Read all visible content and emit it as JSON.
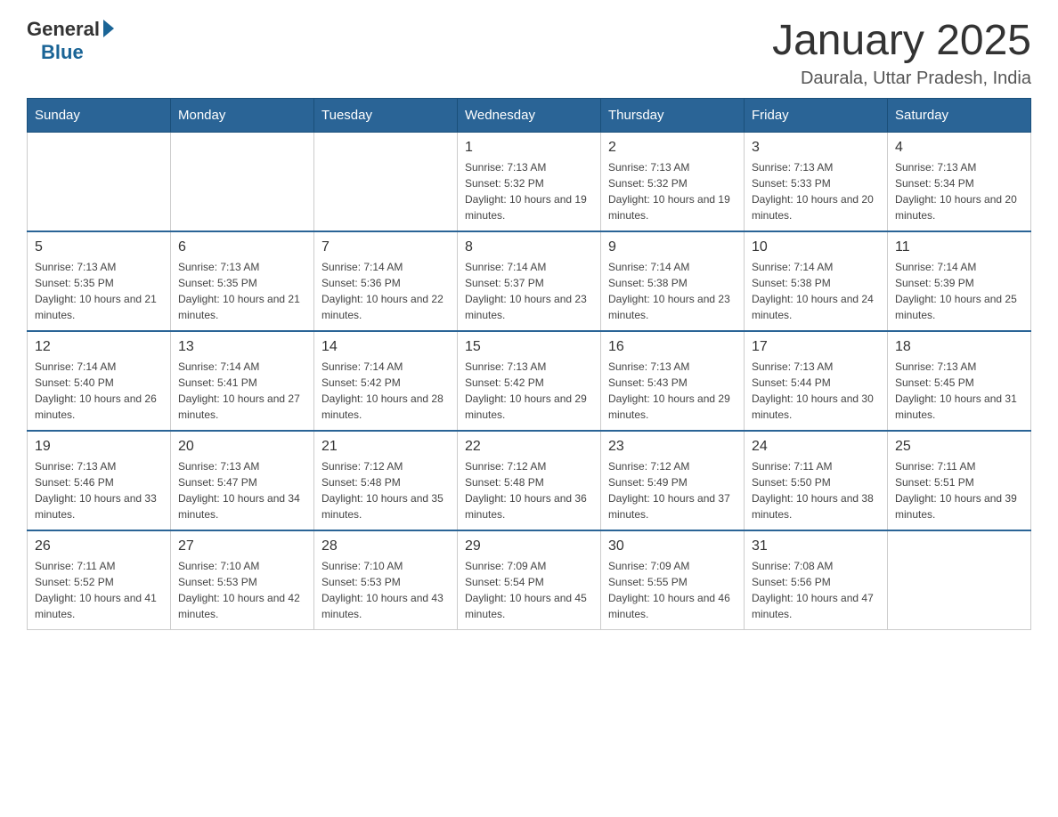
{
  "header": {
    "logo_general": "General",
    "logo_blue": "Blue",
    "title": "January 2025",
    "subtitle": "Daurala, Uttar Pradesh, India"
  },
  "days_of_week": [
    "Sunday",
    "Monday",
    "Tuesday",
    "Wednesday",
    "Thursday",
    "Friday",
    "Saturday"
  ],
  "weeks": [
    [
      {
        "day": "",
        "sunrise": "",
        "sunset": "",
        "daylight": ""
      },
      {
        "day": "",
        "sunrise": "",
        "sunset": "",
        "daylight": ""
      },
      {
        "day": "",
        "sunrise": "",
        "sunset": "",
        "daylight": ""
      },
      {
        "day": "1",
        "sunrise": "Sunrise: 7:13 AM",
        "sunset": "Sunset: 5:32 PM",
        "daylight": "Daylight: 10 hours and 19 minutes."
      },
      {
        "day": "2",
        "sunrise": "Sunrise: 7:13 AM",
        "sunset": "Sunset: 5:32 PM",
        "daylight": "Daylight: 10 hours and 19 minutes."
      },
      {
        "day": "3",
        "sunrise": "Sunrise: 7:13 AM",
        "sunset": "Sunset: 5:33 PM",
        "daylight": "Daylight: 10 hours and 20 minutes."
      },
      {
        "day": "4",
        "sunrise": "Sunrise: 7:13 AM",
        "sunset": "Sunset: 5:34 PM",
        "daylight": "Daylight: 10 hours and 20 minutes."
      }
    ],
    [
      {
        "day": "5",
        "sunrise": "Sunrise: 7:13 AM",
        "sunset": "Sunset: 5:35 PM",
        "daylight": "Daylight: 10 hours and 21 minutes."
      },
      {
        "day": "6",
        "sunrise": "Sunrise: 7:13 AM",
        "sunset": "Sunset: 5:35 PM",
        "daylight": "Daylight: 10 hours and 21 minutes."
      },
      {
        "day": "7",
        "sunrise": "Sunrise: 7:14 AM",
        "sunset": "Sunset: 5:36 PM",
        "daylight": "Daylight: 10 hours and 22 minutes."
      },
      {
        "day": "8",
        "sunrise": "Sunrise: 7:14 AM",
        "sunset": "Sunset: 5:37 PM",
        "daylight": "Daylight: 10 hours and 23 minutes."
      },
      {
        "day": "9",
        "sunrise": "Sunrise: 7:14 AM",
        "sunset": "Sunset: 5:38 PM",
        "daylight": "Daylight: 10 hours and 23 minutes."
      },
      {
        "day": "10",
        "sunrise": "Sunrise: 7:14 AM",
        "sunset": "Sunset: 5:38 PM",
        "daylight": "Daylight: 10 hours and 24 minutes."
      },
      {
        "day": "11",
        "sunrise": "Sunrise: 7:14 AM",
        "sunset": "Sunset: 5:39 PM",
        "daylight": "Daylight: 10 hours and 25 minutes."
      }
    ],
    [
      {
        "day": "12",
        "sunrise": "Sunrise: 7:14 AM",
        "sunset": "Sunset: 5:40 PM",
        "daylight": "Daylight: 10 hours and 26 minutes."
      },
      {
        "day": "13",
        "sunrise": "Sunrise: 7:14 AM",
        "sunset": "Sunset: 5:41 PM",
        "daylight": "Daylight: 10 hours and 27 minutes."
      },
      {
        "day": "14",
        "sunrise": "Sunrise: 7:14 AM",
        "sunset": "Sunset: 5:42 PM",
        "daylight": "Daylight: 10 hours and 28 minutes."
      },
      {
        "day": "15",
        "sunrise": "Sunrise: 7:13 AM",
        "sunset": "Sunset: 5:42 PM",
        "daylight": "Daylight: 10 hours and 29 minutes."
      },
      {
        "day": "16",
        "sunrise": "Sunrise: 7:13 AM",
        "sunset": "Sunset: 5:43 PM",
        "daylight": "Daylight: 10 hours and 29 minutes."
      },
      {
        "day": "17",
        "sunrise": "Sunrise: 7:13 AM",
        "sunset": "Sunset: 5:44 PM",
        "daylight": "Daylight: 10 hours and 30 minutes."
      },
      {
        "day": "18",
        "sunrise": "Sunrise: 7:13 AM",
        "sunset": "Sunset: 5:45 PM",
        "daylight": "Daylight: 10 hours and 31 minutes."
      }
    ],
    [
      {
        "day": "19",
        "sunrise": "Sunrise: 7:13 AM",
        "sunset": "Sunset: 5:46 PM",
        "daylight": "Daylight: 10 hours and 33 minutes."
      },
      {
        "day": "20",
        "sunrise": "Sunrise: 7:13 AM",
        "sunset": "Sunset: 5:47 PM",
        "daylight": "Daylight: 10 hours and 34 minutes."
      },
      {
        "day": "21",
        "sunrise": "Sunrise: 7:12 AM",
        "sunset": "Sunset: 5:48 PM",
        "daylight": "Daylight: 10 hours and 35 minutes."
      },
      {
        "day": "22",
        "sunrise": "Sunrise: 7:12 AM",
        "sunset": "Sunset: 5:48 PM",
        "daylight": "Daylight: 10 hours and 36 minutes."
      },
      {
        "day": "23",
        "sunrise": "Sunrise: 7:12 AM",
        "sunset": "Sunset: 5:49 PM",
        "daylight": "Daylight: 10 hours and 37 minutes."
      },
      {
        "day": "24",
        "sunrise": "Sunrise: 7:11 AM",
        "sunset": "Sunset: 5:50 PM",
        "daylight": "Daylight: 10 hours and 38 minutes."
      },
      {
        "day": "25",
        "sunrise": "Sunrise: 7:11 AM",
        "sunset": "Sunset: 5:51 PM",
        "daylight": "Daylight: 10 hours and 39 minutes."
      }
    ],
    [
      {
        "day": "26",
        "sunrise": "Sunrise: 7:11 AM",
        "sunset": "Sunset: 5:52 PM",
        "daylight": "Daylight: 10 hours and 41 minutes."
      },
      {
        "day": "27",
        "sunrise": "Sunrise: 7:10 AM",
        "sunset": "Sunset: 5:53 PM",
        "daylight": "Daylight: 10 hours and 42 minutes."
      },
      {
        "day": "28",
        "sunrise": "Sunrise: 7:10 AM",
        "sunset": "Sunset: 5:53 PM",
        "daylight": "Daylight: 10 hours and 43 minutes."
      },
      {
        "day": "29",
        "sunrise": "Sunrise: 7:09 AM",
        "sunset": "Sunset: 5:54 PM",
        "daylight": "Daylight: 10 hours and 45 minutes."
      },
      {
        "day": "30",
        "sunrise": "Sunrise: 7:09 AM",
        "sunset": "Sunset: 5:55 PM",
        "daylight": "Daylight: 10 hours and 46 minutes."
      },
      {
        "day": "31",
        "sunrise": "Sunrise: 7:08 AM",
        "sunset": "Sunset: 5:56 PM",
        "daylight": "Daylight: 10 hours and 47 minutes."
      },
      {
        "day": "",
        "sunrise": "",
        "sunset": "",
        "daylight": ""
      }
    ]
  ]
}
